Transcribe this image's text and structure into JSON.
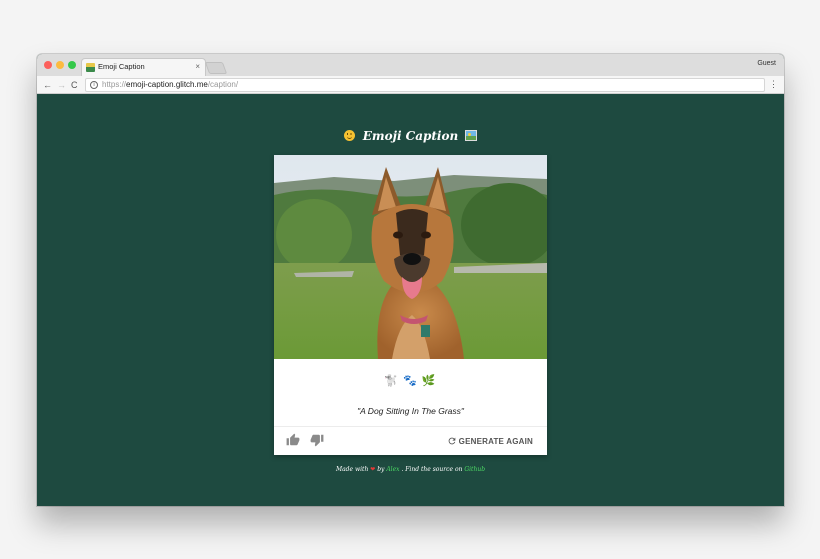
{
  "browser": {
    "tab_title": "Emoji Caption",
    "tab_close": "×",
    "profile": "Guest",
    "url_scheme": "https://",
    "url_host": "emoji-caption.glitch.me",
    "url_path": "/caption/",
    "back_glyph": "←",
    "forward_glyph": "→",
    "reload_glyph": "C",
    "menu_glyph": "⋮"
  },
  "app": {
    "title": "Emoji Caption"
  },
  "card": {
    "emojis": {
      "dog": "🐩",
      "paws": "🐾",
      "leaf": "🌿"
    },
    "caption": "\"A Dog Sitting In The Grass\"",
    "generate_label": "GENERATE AGAIN"
  },
  "footer": {
    "made_with": "Made with",
    "heart": "❤",
    "by": "by",
    "author": "Alex",
    "find_source": ". Find the source on",
    "source_link": "Github"
  },
  "colors": {
    "page_background": "#1e4a40",
    "footer_link": "#4cd964"
  }
}
